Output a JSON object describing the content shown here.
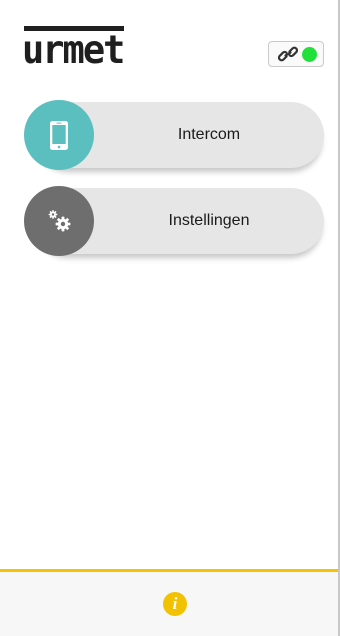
{
  "header": {
    "logo_text": "urmet",
    "connection_icon": "link-icon",
    "connection_status": "connected",
    "status_color": "#22e03a"
  },
  "menu": {
    "items": [
      {
        "label": "Intercom",
        "icon": "smartphone-icon",
        "color": "#5bbfbf"
      },
      {
        "label": "Instellingen",
        "icon": "gears-icon",
        "color": "#6e6e6e"
      }
    ]
  },
  "footer": {
    "info_icon": "info-icon",
    "info_glyph": "i",
    "accent_color": "#f5c400"
  }
}
